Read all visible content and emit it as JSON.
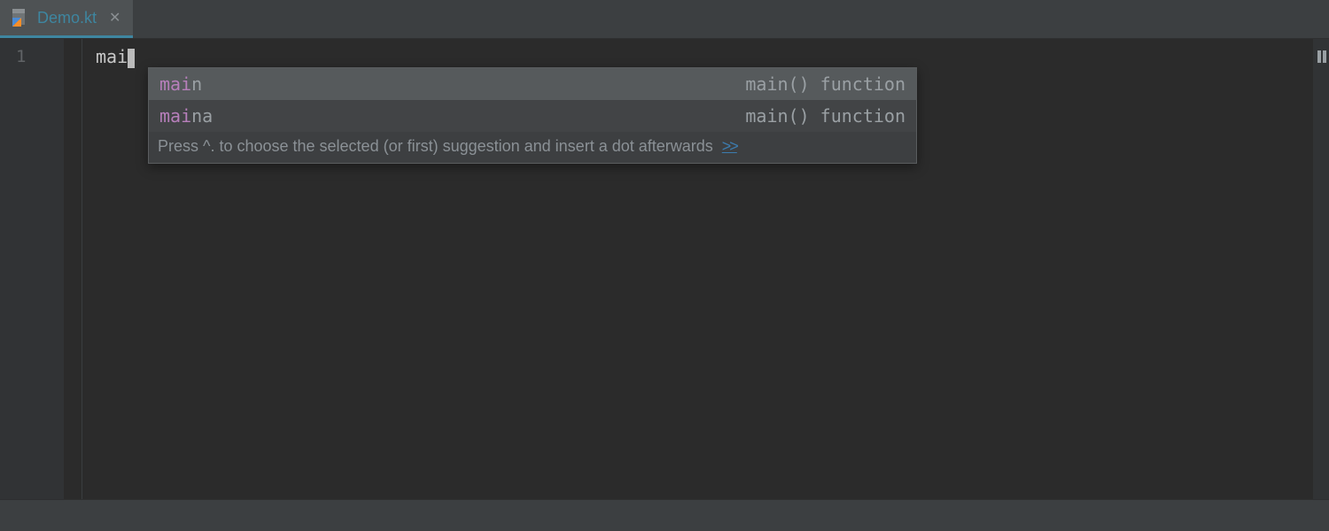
{
  "tab": {
    "filename": "Demo.kt",
    "icon": "kotlin-file-icon"
  },
  "editor": {
    "line_number": "1",
    "typed_text": "mai"
  },
  "autocomplete": {
    "items": [
      {
        "match": "mai",
        "rest": "n",
        "desc": "main() function"
      },
      {
        "match": "mai",
        "rest": "na",
        "desc": "main() function"
      }
    ],
    "hint": "Press ^. to choose the selected (or first) suggestion and insert a dot afterwards",
    "more_symbol": ">>"
  }
}
